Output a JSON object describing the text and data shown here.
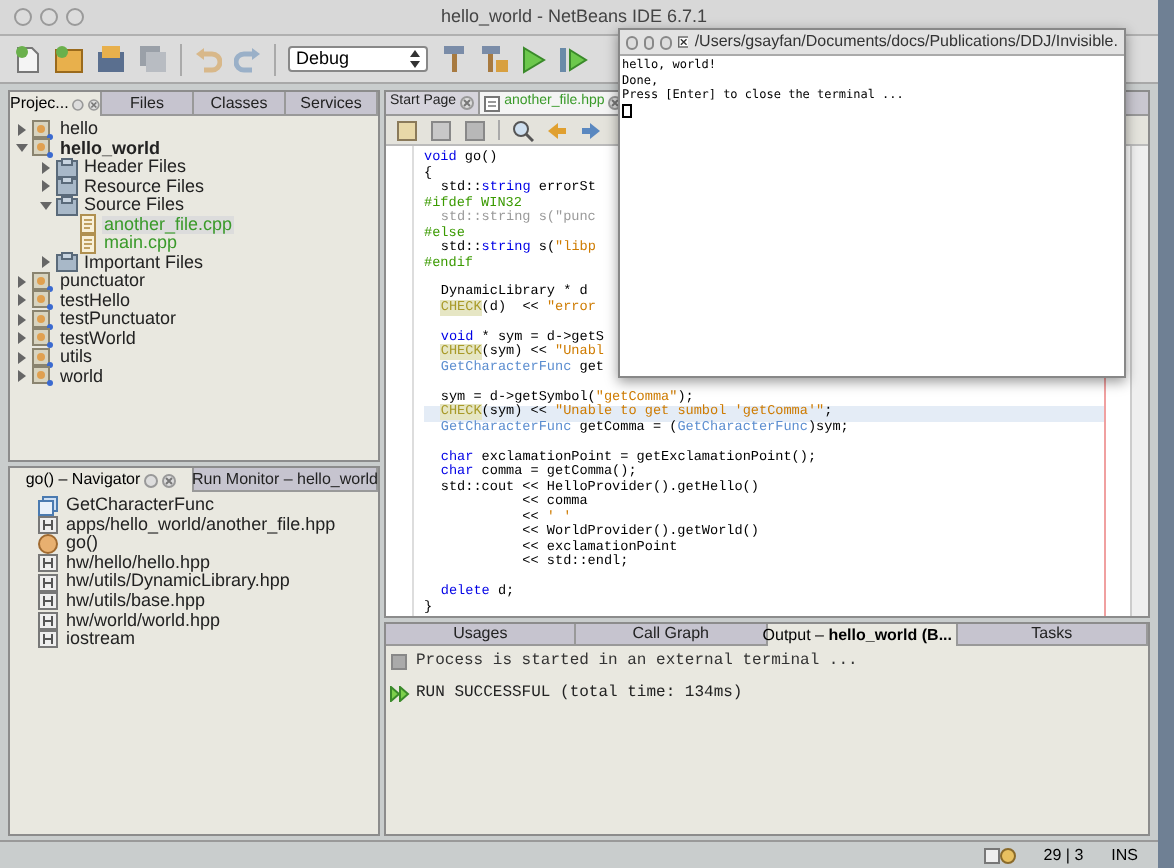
{
  "window": {
    "title": "hello_world - NetBeans IDE 6.7.1"
  },
  "toolbar": {
    "configuration": "Debug"
  },
  "projects_panel": {
    "tabs": [
      {
        "label": "Projec...",
        "selected": true
      },
      {
        "label": "Files",
        "selected": false
      },
      {
        "label": "Classes",
        "selected": false
      },
      {
        "label": "Services",
        "selected": false
      }
    ],
    "tree": [
      {
        "label": "hello",
        "kind": "project",
        "main": false,
        "expanded": false,
        "selected": false
      },
      {
        "label": "hello_world",
        "kind": "project",
        "main": true,
        "expanded": true,
        "selected": false,
        "children": [
          {
            "label": "Header Files",
            "kind": "folder",
            "expanded": false,
            "selected": false
          },
          {
            "label": "Resource Files",
            "kind": "folder",
            "expanded": false,
            "selected": false
          },
          {
            "label": "Source Files",
            "kind": "folder",
            "expanded": true,
            "selected": false,
            "children": [
              {
                "label": "another_file.cpp",
                "kind": "file",
                "selected": true
              },
              {
                "label": "main.cpp",
                "kind": "file",
                "selected": false
              }
            ]
          },
          {
            "label": "Important Files",
            "kind": "folder",
            "expanded": false,
            "selected": false
          }
        ]
      },
      {
        "label": "punctuator",
        "kind": "project",
        "main": false,
        "expanded": false,
        "selected": false
      },
      {
        "label": "testHello",
        "kind": "project",
        "main": false,
        "expanded": false,
        "selected": false
      },
      {
        "label": "testPunctuator",
        "kind": "project",
        "main": false,
        "expanded": false,
        "selected": false
      },
      {
        "label": "testWorld",
        "kind": "project",
        "main": false,
        "expanded": false,
        "selected": false
      },
      {
        "label": "utils",
        "kind": "project",
        "main": false,
        "expanded": false,
        "selected": false
      },
      {
        "label": "world",
        "kind": "project",
        "main": false,
        "expanded": false,
        "selected": false
      }
    ]
  },
  "navigator_panel": {
    "tabs": [
      {
        "label": "go() – Navigator",
        "selected": true
      },
      {
        "label": "Run Monitor – hello_world",
        "selected": false
      }
    ],
    "items": [
      {
        "label": "GetCharacterFunc",
        "kind": "class"
      },
      {
        "label": "apps/hello_world/another_file.hpp",
        "kind": "include"
      },
      {
        "label": "go()",
        "kind": "function"
      },
      {
        "label": "hw/hello/hello.hpp",
        "kind": "include"
      },
      {
        "label": "hw/utils/DynamicLibrary.hpp",
        "kind": "include"
      },
      {
        "label": "hw/utils/base.hpp",
        "kind": "include"
      },
      {
        "label": "hw/world/world.hpp",
        "kind": "include"
      },
      {
        "label": "iostream",
        "kind": "include"
      }
    ]
  },
  "editor": {
    "tabs": [
      {
        "label": "Start Page",
        "selected": false
      },
      {
        "label": "another_file.hpp",
        "selected": true
      }
    ],
    "lines": [
      {
        "kind": "code",
        "indented": false,
        "current": false,
        "segments": [
          {
            "text": "void",
            "kind": "kw"
          },
          {
            "text": " go()",
            "kind": "plain"
          }
        ]
      },
      {
        "kind": "code",
        "indented": false,
        "current": false,
        "segments": [
          {
            "text": "{",
            "kind": "plain"
          }
        ]
      },
      {
        "kind": "code",
        "indented": true,
        "current": false,
        "segments": [
          {
            "text": "std::",
            "kind": "plain"
          },
          {
            "text": "string",
            "kind": "kw"
          },
          {
            "text": " errorSt",
            "kind": "plain"
          }
        ]
      },
      {
        "kind": "code",
        "indented": false,
        "current": false,
        "segments": [
          {
            "text": "#ifdef WIN32",
            "kind": "pp"
          }
        ]
      },
      {
        "kind": "code",
        "indented": true,
        "current": false,
        "segments": [
          {
            "text": "std::string s(\"punc",
            "kind": "inactive"
          }
        ]
      },
      {
        "kind": "code",
        "indented": false,
        "current": false,
        "segments": [
          {
            "text": "#else",
            "kind": "pp"
          }
        ]
      },
      {
        "kind": "code",
        "indented": true,
        "current": false,
        "segments": [
          {
            "text": "std::",
            "kind": "plain"
          },
          {
            "text": "string",
            "kind": "kw"
          },
          {
            "text": " s(",
            "kind": "plain"
          },
          {
            "text": "\"libp",
            "kind": "str"
          }
        ]
      },
      {
        "kind": "code",
        "indented": false,
        "current": false,
        "segments": [
          {
            "text": "#endif",
            "kind": "pp"
          }
        ]
      },
      {
        "kind": "blank"
      },
      {
        "kind": "code",
        "indented": true,
        "current": false,
        "segments": [
          {
            "text": "DynamicLibrary * d",
            "kind": "plain"
          }
        ]
      },
      {
        "kind": "code",
        "indented": true,
        "current": false,
        "segments": [
          {
            "text": "CHECK",
            "kind": "macro"
          },
          {
            "text": "(d)  << ",
            "kind": "plain"
          },
          {
            "text": "\"error",
            "kind": "str"
          }
        ]
      },
      {
        "kind": "blank"
      },
      {
        "kind": "code",
        "indented": true,
        "current": false,
        "segments": [
          {
            "text": "void",
            "kind": "kw"
          },
          {
            "text": " * sym = d->getS",
            "kind": "plain"
          }
        ]
      },
      {
        "kind": "code",
        "indented": true,
        "current": false,
        "segments": [
          {
            "text": "CHECK",
            "kind": "macro"
          },
          {
            "text": "(sym) << ",
            "kind": "plain"
          },
          {
            "text": "\"Unabl",
            "kind": "str"
          }
        ]
      },
      {
        "kind": "code",
        "indented": true,
        "current": false,
        "segments": [
          {
            "text": "GetCharacterFunc",
            "kind": "type"
          },
          {
            "text": " get",
            "kind": "plain"
          }
        ]
      },
      {
        "kind": "blank"
      },
      {
        "kind": "code",
        "indented": true,
        "current": false,
        "segments": [
          {
            "text": "sym = d->getSymbol(",
            "kind": "plain"
          },
          {
            "text": "\"getComma\"",
            "kind": "str"
          },
          {
            "text": ");",
            "kind": "plain"
          }
        ]
      },
      {
        "kind": "code",
        "indented": true,
        "current": true,
        "segments": [
          {
            "text": "CHECK",
            "kind": "macro"
          },
          {
            "text": "(sym) << ",
            "kind": "plain"
          },
          {
            "text": "\"Unable to get sumbol 'getComma'\"",
            "kind": "str"
          },
          {
            "text": ";",
            "kind": "plain"
          }
        ]
      },
      {
        "kind": "code",
        "indented": true,
        "current": false,
        "segments": [
          {
            "text": "GetCharacterFunc",
            "kind": "type"
          },
          {
            "text": " getComma = (",
            "kind": "plain"
          },
          {
            "text": "GetCharacterFunc",
            "kind": "type"
          },
          {
            "text": ")sym;",
            "kind": "plain"
          }
        ]
      },
      {
        "kind": "blank"
      },
      {
        "kind": "code",
        "indented": true,
        "current": false,
        "segments": [
          {
            "text": "char",
            "kind": "kw"
          },
          {
            "text": " exclamationPoint = getExclamationPoint();",
            "kind": "plain"
          }
        ]
      },
      {
        "kind": "code",
        "indented": true,
        "current": false,
        "segments": [
          {
            "text": "char",
            "kind": "kw"
          },
          {
            "text": " comma = getComma();",
            "kind": "plain"
          }
        ]
      },
      {
        "kind": "code",
        "indented": true,
        "current": false,
        "segments": [
          {
            "text": "std::cout << HelloProvider().getHello()",
            "kind": "plain"
          }
        ]
      },
      {
        "kind": "code",
        "indented": true,
        "current": false,
        "segments": [
          {
            "text": "          << comma",
            "kind": "plain"
          }
        ]
      },
      {
        "kind": "code",
        "indented": true,
        "current": false,
        "segments": [
          {
            "text": "          << ",
            "kind": "plain"
          },
          {
            "text": "' '",
            "kind": "str"
          }
        ]
      },
      {
        "kind": "code",
        "indented": true,
        "current": false,
        "segments": [
          {
            "text": "          << WorldProvider().getWorld()",
            "kind": "plain"
          }
        ]
      },
      {
        "kind": "code",
        "indented": true,
        "current": false,
        "segments": [
          {
            "text": "          << exclamationPoint",
            "kind": "plain"
          }
        ]
      },
      {
        "kind": "code",
        "indented": true,
        "current": false,
        "segments": [
          {
            "text": "          << std::endl;",
            "kind": "plain"
          }
        ]
      },
      {
        "kind": "blank"
      },
      {
        "kind": "code",
        "indented": true,
        "current": false,
        "segments": [
          {
            "text": "delete",
            "kind": "kw"
          },
          {
            "text": " d;",
            "kind": "plain"
          }
        ]
      },
      {
        "kind": "code",
        "indented": false,
        "current": false,
        "segments": [
          {
            "text": "}",
            "kind": "plain"
          }
        ]
      }
    ]
  },
  "terminal": {
    "title": "/Users/gsayfan/Documents/docs/Publications/DDJ/Invisible.",
    "lines": [
      "hello, world!",
      "Done,",
      "Press [Enter] to close the terminal ..."
    ]
  },
  "output_panel": {
    "tabs": [
      {
        "label": "Usages",
        "selected": false
      },
      {
        "label": "Call Graph",
        "selected": false
      },
      {
        "label": "Output – **hello_world (B...**",
        "selected": true
      },
      {
        "label": "Tasks",
        "selected": false
      }
    ],
    "lines": [
      {
        "text": "Process is started in an external terminal ...",
        "kind": "info"
      },
      {
        "text": "RUN SUCCESSFUL (total time: 134ms)",
        "kind": "success"
      }
    ]
  },
  "status_bar": {
    "position": "29 | 3",
    "mode": "INS"
  }
}
